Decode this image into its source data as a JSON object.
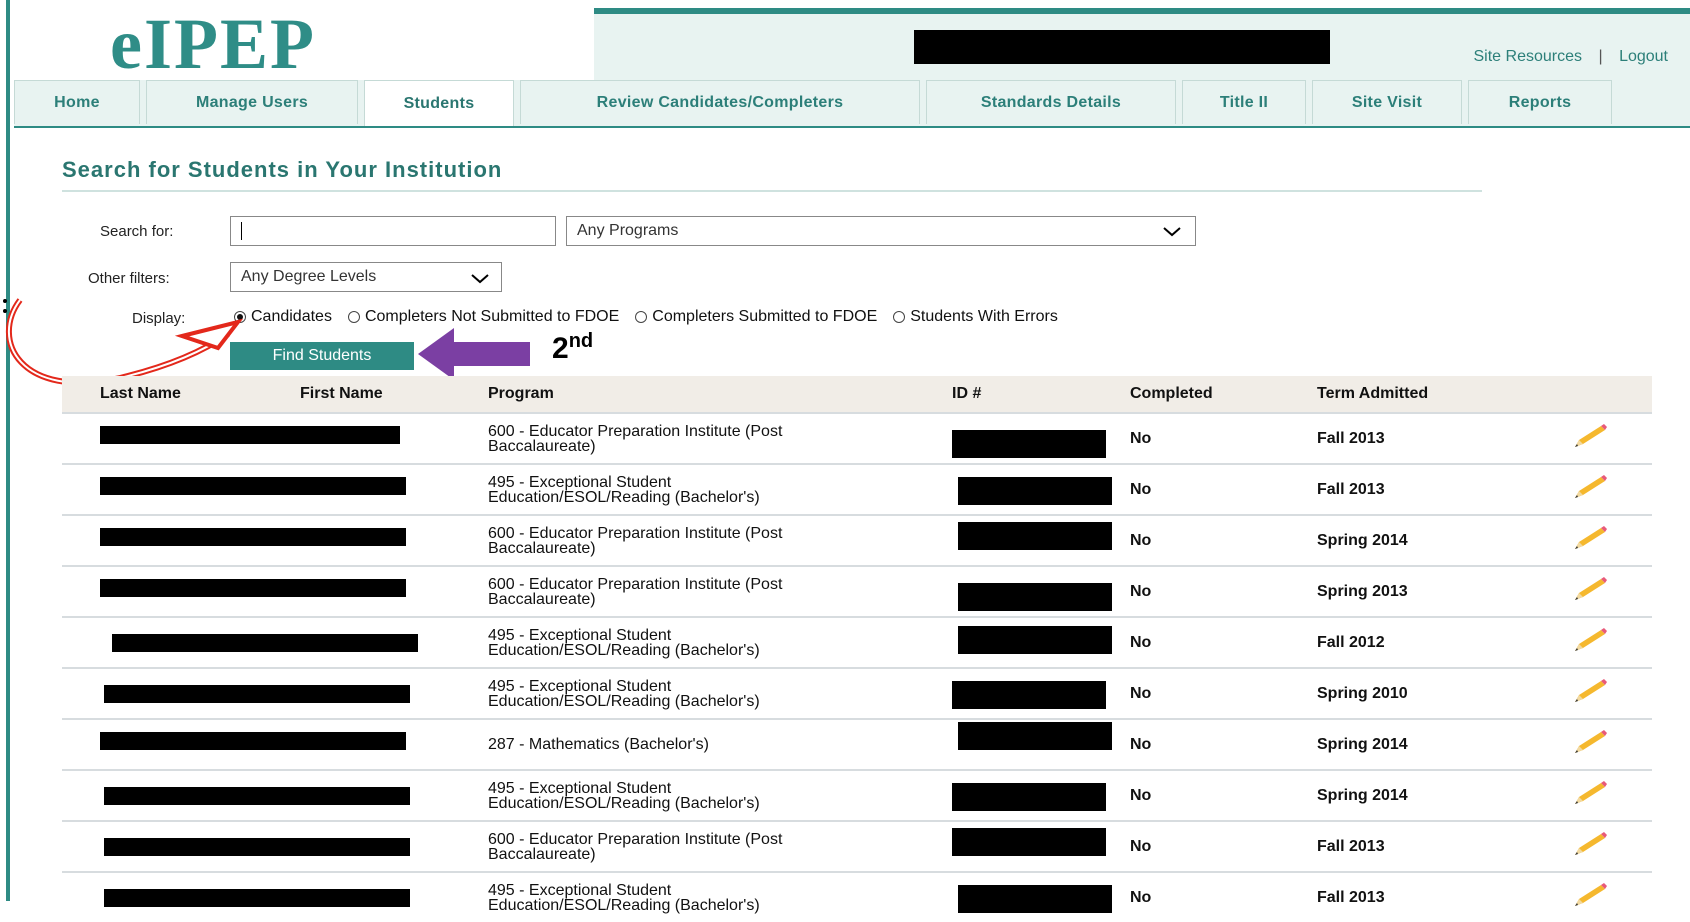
{
  "brand": {
    "logo": "eIPEP"
  },
  "top_links": {
    "site_resources": "Site Resources",
    "separator": "|",
    "logout": "Logout"
  },
  "tabs": [
    {
      "label": "Home"
    },
    {
      "label": "Manage Users"
    },
    {
      "label": "Students"
    },
    {
      "label": "Review Candidates/Completers"
    },
    {
      "label": "Standards Details"
    },
    {
      "label": "Title II"
    },
    {
      "label": "Site Visit"
    },
    {
      "label": "Reports"
    }
  ],
  "page": {
    "title": "Search for Students in Your Institution"
  },
  "search": {
    "search_for_label": "Search for:",
    "search_value": "",
    "program_select": "Any Programs",
    "other_filters_label": "Other filters:",
    "degree_select": "Any Degree Levels",
    "display_label": "Display:",
    "options": [
      {
        "label": "Candidates",
        "checked": true
      },
      {
        "label": "Completers Not Submitted to FDOE",
        "checked": false
      },
      {
        "label": "Completers Submitted to FDOE",
        "checked": false
      },
      {
        "label": "Students With Errors",
        "checked": false
      }
    ],
    "find_button": "Find Students"
  },
  "annotation": {
    "text": "2",
    "suffix": "nd"
  },
  "table": {
    "headers": [
      "Last Name",
      "First Name",
      "Program",
      "ID #",
      "Completed",
      "Term Admitted"
    ],
    "rows": [
      {
        "program_line1": "600 - Educator Preparation Institute (Post",
        "program_line2": "Baccalaureate)",
        "completed": "No",
        "term": "Fall 2013"
      },
      {
        "program_line1": "495 - Exceptional Student",
        "program_line2": "Education/ESOL/Reading (Bachelor's)",
        "completed": "No",
        "term": "Fall 2013"
      },
      {
        "program_line1": "600 - Educator Preparation Institute (Post",
        "program_line2": "Baccalaureate)",
        "completed": "No",
        "term": "Spring 2014"
      },
      {
        "program_line1": "600 - Educator Preparation Institute (Post",
        "program_line2": "Baccalaureate)",
        "completed": "No",
        "term": "Spring 2013"
      },
      {
        "program_line1": "495 - Exceptional Student",
        "program_line2": "Education/ESOL/Reading (Bachelor's)",
        "completed": "No",
        "term": "Fall 2012"
      },
      {
        "program_line1": "495 - Exceptional Student",
        "program_line2": "Education/ESOL/Reading (Bachelor's)",
        "completed": "No",
        "term": "Spring 2010"
      },
      {
        "program_line1": "287 - Mathematics (Bachelor's)",
        "program_line2": "",
        "completed": "No",
        "term": "Spring 2014"
      },
      {
        "program_line1": "495 - Exceptional Student",
        "program_line2": "Education/ESOL/Reading (Bachelor's)",
        "completed": "No",
        "term": "Spring 2014"
      },
      {
        "program_line1": "600 - Educator Preparation Institute (Post",
        "program_line2": "Baccalaureate)",
        "completed": "No",
        "term": "Fall 2013"
      },
      {
        "program_line1": "495 - Exceptional Student",
        "program_line2": "Education/ESOL/Reading (Bachelor's)",
        "completed": "No",
        "term": "Fall 2013"
      }
    ]
  },
  "icons": {
    "edit": "pencil-icon",
    "dropdown": "chevron-down-icon"
  },
  "colors": {
    "teal": "#2e8b84",
    "header_bg": "#e8f3f1",
    "table_header_bg": "#f1ede7",
    "annotation_red": "#e3281b",
    "annotation_purple": "#7b3fa3"
  }
}
